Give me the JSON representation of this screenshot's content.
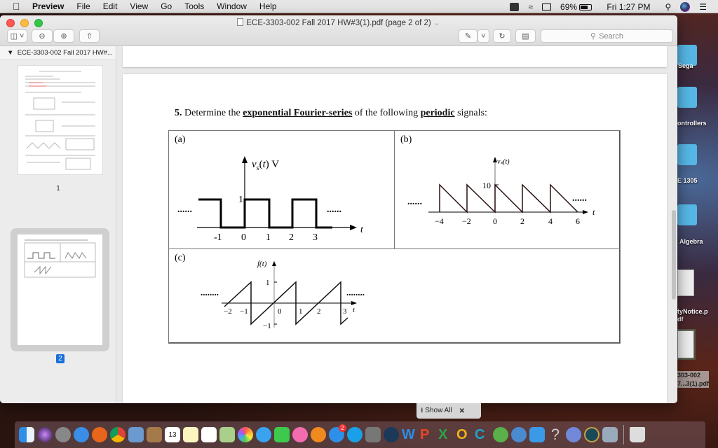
{
  "menubar": {
    "app": "Preview",
    "items": [
      "File",
      "Edit",
      "View",
      "Go",
      "Tools",
      "Window",
      "Help"
    ],
    "battery": "69%",
    "clock": "Fri 1:27 PM"
  },
  "window": {
    "title": "ECE-3303-002 Fall 2017 HW#3(1).pdf (page 2 of 2)",
    "search_placeholder": "Search"
  },
  "sidebar": {
    "header": "ECE-3303-002 Fall 2017 HW#...",
    "pages": [
      {
        "label": "1"
      },
      {
        "label": "2",
        "selected": true
      }
    ]
  },
  "document": {
    "question_num": "5.",
    "q_part1": "Determine the",
    "q_term1": "exponential Fourier-series",
    "q_part2": "of the following",
    "q_term2": "periodic",
    "q_part3": "signals:",
    "panels": {
      "a": {
        "label": "(a)",
        "ylabel": "vₛ(t) V",
        "xlabel": "t",
        "ytick": "1",
        "xticks": [
          "-1",
          "0",
          "1",
          "2",
          "3"
        ],
        "dots": "......"
      },
      "b": {
        "label": "(b)",
        "ylabel": "vₛ(t)",
        "xlabel": "t",
        "ytick": "10",
        "xticks": [
          "−4",
          "−2",
          "0",
          "2",
          "4",
          "6"
        ],
        "dots": "......"
      },
      "c": {
        "label": "(c)",
        "ylabel": "f(t)",
        "xlabel": "t",
        "yticks": [
          "1",
          "−1"
        ],
        "xticks": [
          "−2",
          "−1",
          "0",
          "1",
          "2",
          "3"
        ],
        "dots": "........"
      }
    }
  },
  "downloads": {
    "show_all": "Show All",
    "close": "✕"
  },
  "desktop": {
    "items": [
      "Sega",
      "ontrollers",
      "E 1305",
      "Algebra",
      "tyNotice.p\ndf",
      "303-002\n7...3(1).pdf"
    ]
  },
  "dock": {
    "apps": [
      "Finder",
      "Siri",
      "Launchpad",
      "Safari",
      "Firefox",
      "Chrome",
      "Preview",
      "Contacts",
      "Calendar",
      "Notes",
      "Reminders",
      "Maps",
      "Photos",
      "Messages",
      "FaceTime",
      "iTunes",
      "iBooks",
      "App Store",
      "Skype",
      "System Preferences",
      "Steam",
      "Word",
      "PowerPoint",
      "Excel",
      "Outlook",
      "Cortana",
      "Messenger",
      "Network",
      "Xcode",
      "Help",
      "Discord",
      "League of Legends",
      "Image Capture",
      "Trash"
    ],
    "calendar_day": "13",
    "calendar_month": "OCT",
    "appstore_badge": "2"
  }
}
